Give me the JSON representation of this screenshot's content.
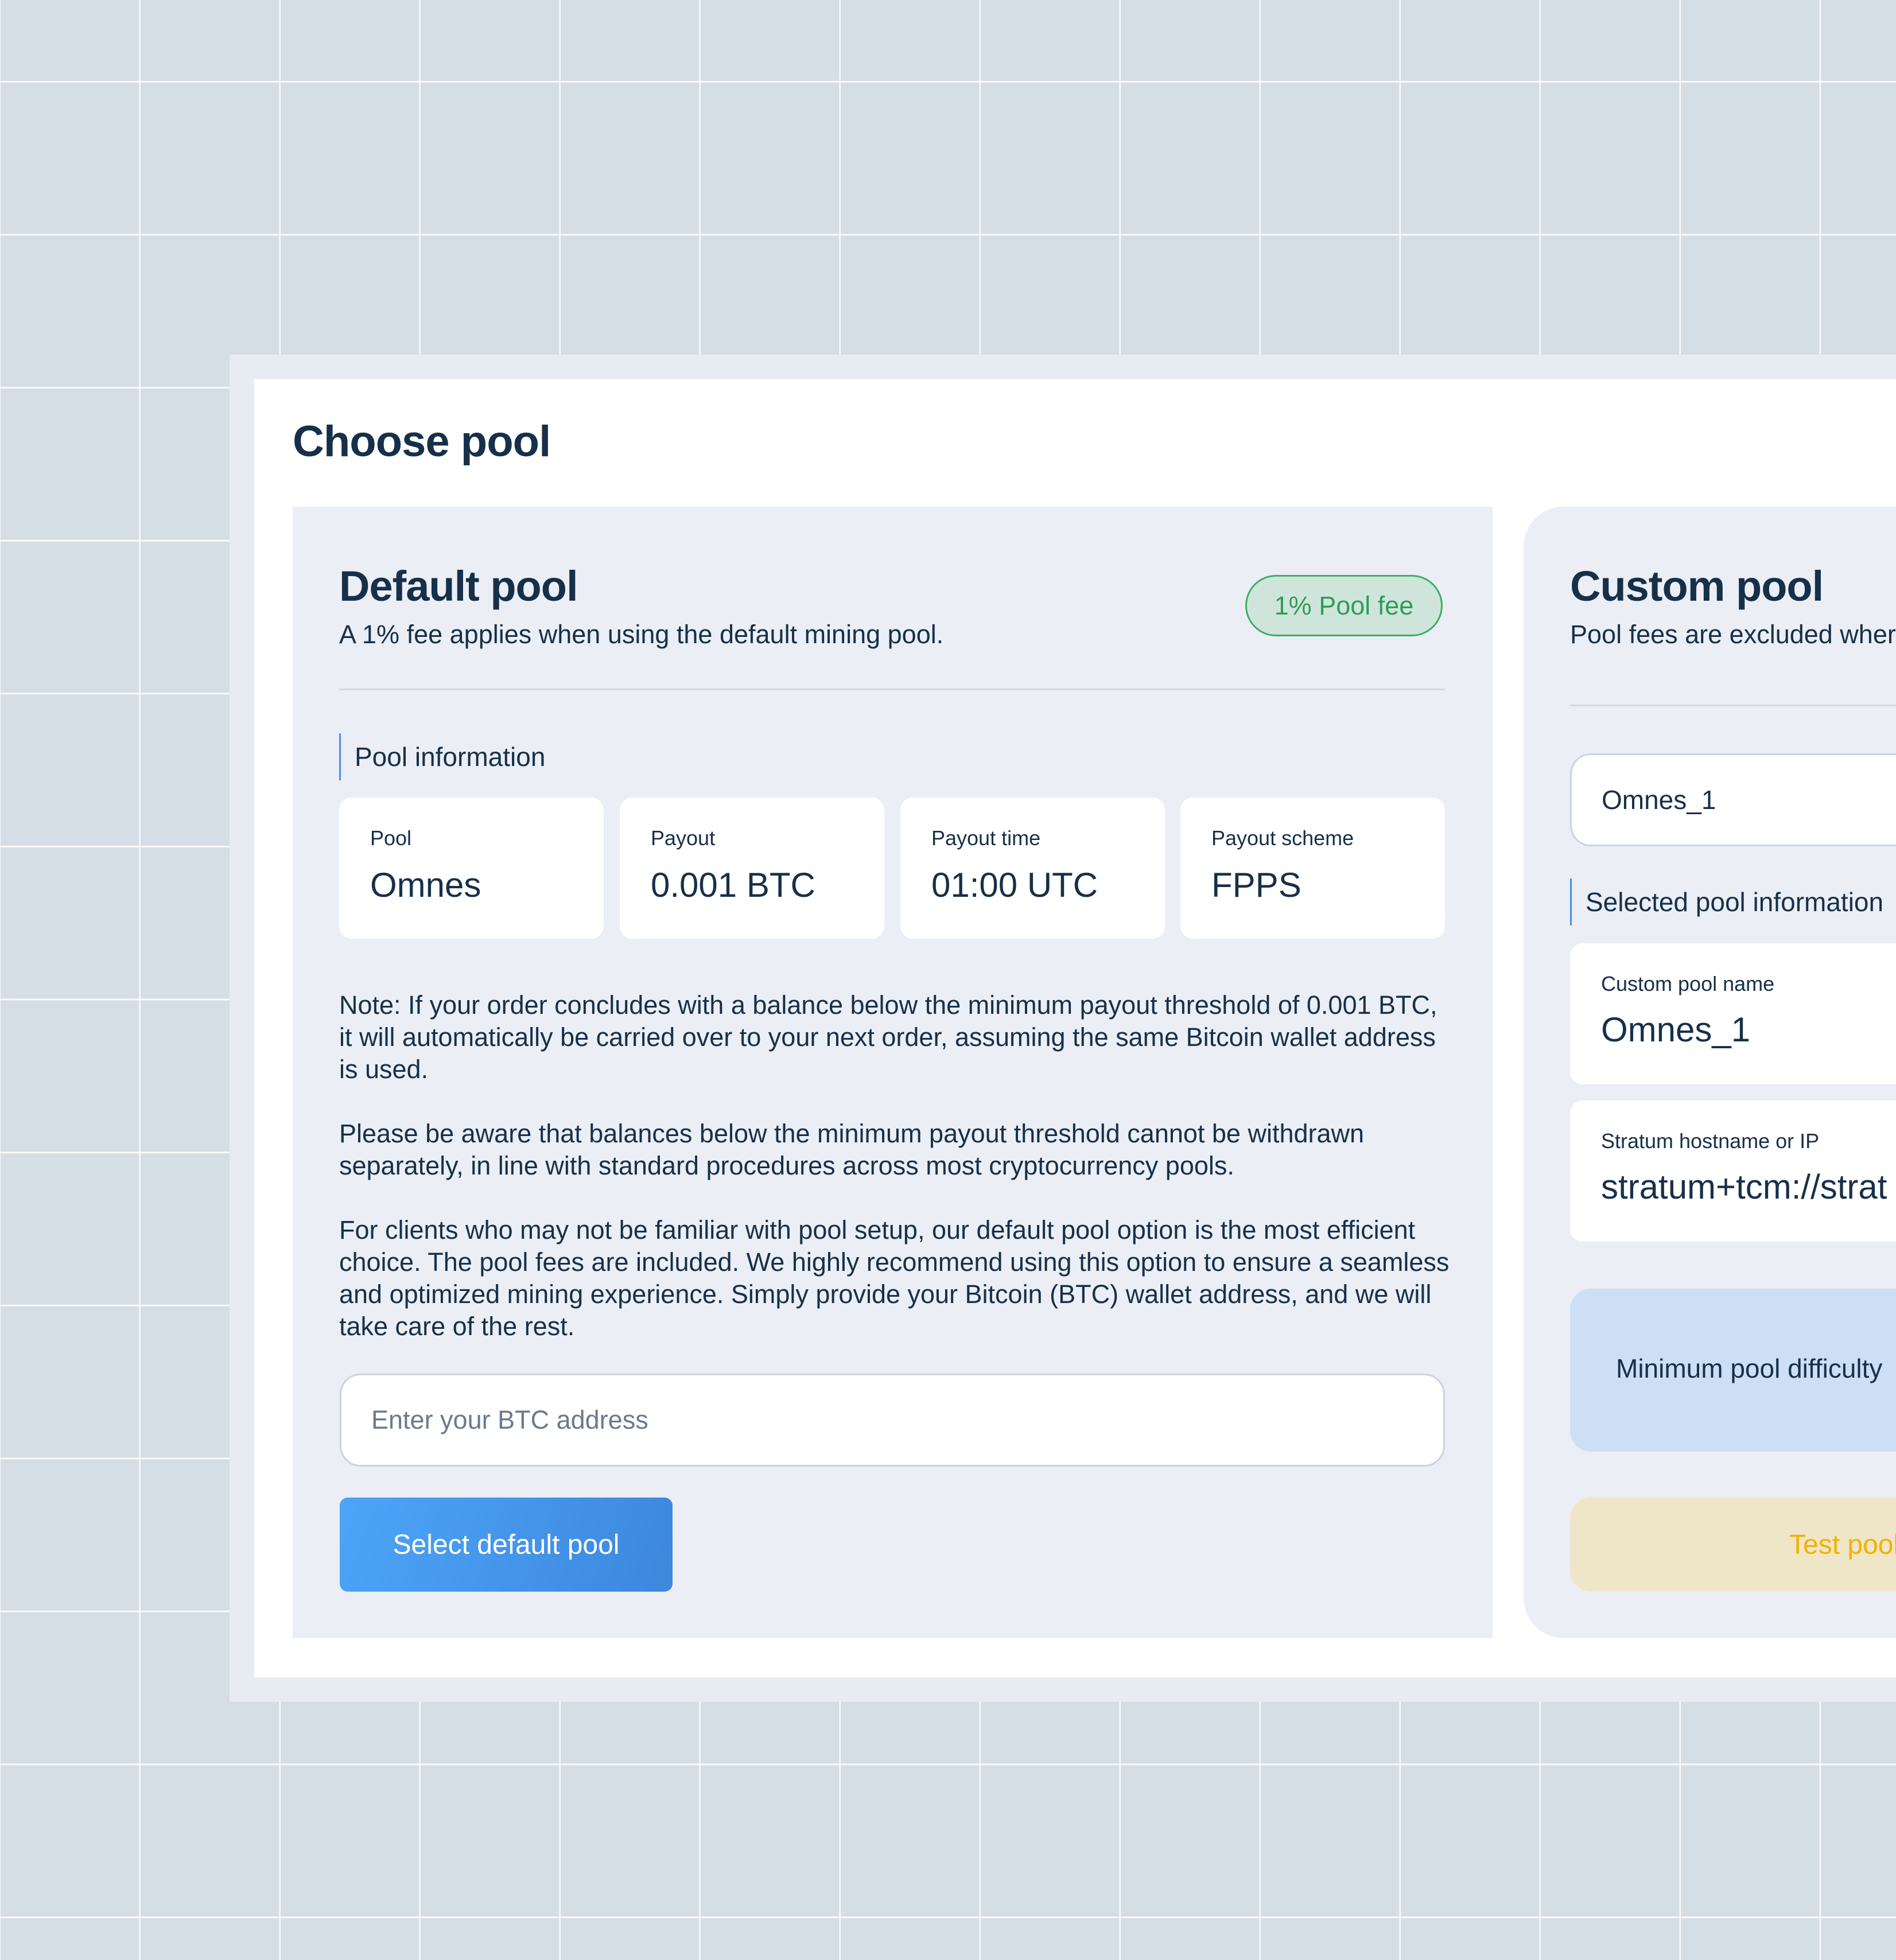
{
  "page": {
    "title": "Choose pool"
  },
  "default_pool": {
    "title": "Default pool",
    "subtitle": "A 1% fee applies when using the default mining pool.",
    "badge": "1% Pool fee",
    "section_label": "Pool information",
    "info_cards": [
      {
        "label": "Pool",
        "value": "Omnes"
      },
      {
        "label": "Payout",
        "value": "0.001 BTC"
      },
      {
        "label": "Payout time",
        "value": "01:00 UTC"
      },
      {
        "label": "Payout scheme",
        "value": "FPPS"
      }
    ],
    "notes": [
      "Note: If your order concludes with a balance below the minimum payout threshold of 0.001 BTC, it will automatically be carried over to your next order, assuming the same Bitcoin wallet address is used.",
      "Please be aware that balances below the minimum payout threshold cannot be withdrawn separately, in line with standard procedures across most cryptocurrency pools.",
      "For clients who may not be familiar with pool setup, our default pool option is the most efficient choice. The pool fees are included. We highly recommend using this option to ensure a seamless and optimized mining experience. Simply provide your Bitcoin (BTC) wallet address, and we will take care of the rest."
    ],
    "btc_input": {
      "value": "",
      "placeholder": "Enter your BTC address"
    },
    "select_button": "Select default pool"
  },
  "custom_pool": {
    "title": "Custom pool",
    "subtitle": "Pool fees are excluded wher",
    "selected_value": "Omnes_1",
    "section_label": "Selected pool information",
    "info_cards": [
      {
        "label": "Custom pool name",
        "value": "Omnes_1"
      },
      {
        "label": "Stratum hostname or IP",
        "value": "stratum+tcm://strat"
      }
    ],
    "difficulty_text": "Minimum pool difficulty",
    "test_button": "Test pool"
  },
  "colors": {
    "background": "#d5dde5",
    "panel": "#ebeef5",
    "text": "#173049",
    "accent_blue": "#4a90e2",
    "badge_green": "#2e9e55",
    "test_yellow": "#f2b200"
  }
}
